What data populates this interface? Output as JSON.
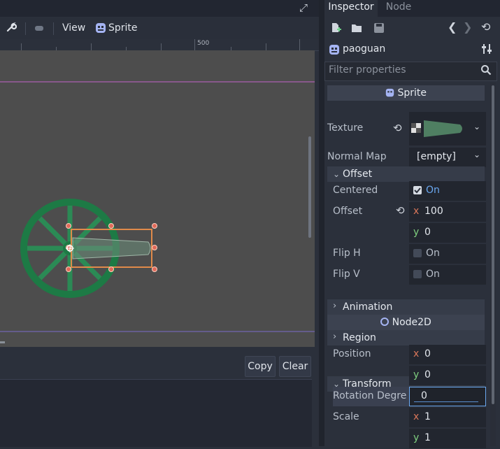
{
  "toolbar": {
    "view_label": "View",
    "sprite_label": "Sprite"
  },
  "ruler": {
    "mark_500": "500"
  },
  "output": {
    "copy_label": "Copy",
    "clear_label": "Clear"
  },
  "inspector": {
    "tab_inspector": "Inspector",
    "tab_node": "Node",
    "object_name": "paoguan",
    "filter_placeholder": "Filter properties",
    "sprite_section": "Sprite",
    "texture_label": "Texture",
    "normal_map_label": "Normal Map",
    "normal_map_value": "[empty]",
    "offset_group": "Offset",
    "centered_label": "Centered",
    "centered_value": "On",
    "offset_label": "Offset",
    "offset_x": "100",
    "offset_y": "0",
    "flip_h_label": "Flip H",
    "flip_h_value": "On",
    "flip_v_label": "Flip V",
    "flip_v_value": "On",
    "animation_group": "Animation",
    "region_group": "Region",
    "node2d_section": "Node2D",
    "transform_group": "Transform",
    "position_label": "Position",
    "position_x": "0",
    "position_y": "0",
    "rotation_label": "Rotation Degre",
    "rotation_value": "0",
    "scale_label": "Scale",
    "scale_x": "1",
    "scale_y": "1",
    "axis_x": "x",
    "axis_y": "y"
  },
  "colors": {
    "accent": "#6aa8f0",
    "selection": "#e08a4a",
    "wheel": "#1d7a45",
    "viewport_bg": "#4d4d4d"
  }
}
